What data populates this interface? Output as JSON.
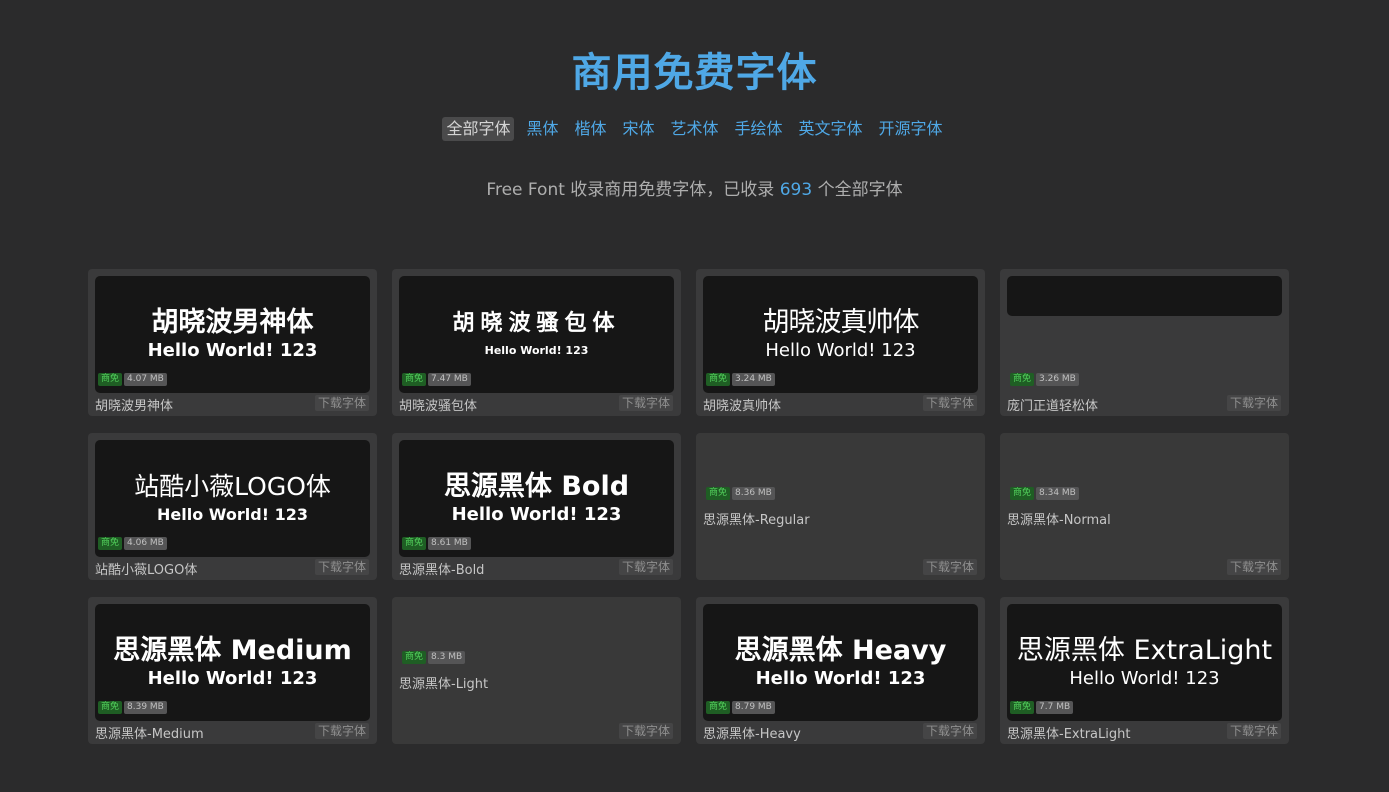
{
  "header": {
    "title": "商用免费字体",
    "nav": [
      "全部字体",
      "黑体",
      "楷体",
      "宋体",
      "艺术体",
      "手绘体",
      "英文字体",
      "开源字体"
    ],
    "subtitle_prefix": "Free Font 收录商用免费字体，已收录",
    "count": "693",
    "subtitle_suffix": "个全部字体"
  },
  "colors": {
    "accent": "#4fa8e6",
    "background": "#2b2b2c",
    "free_badge": "#52d05c"
  },
  "labels": {
    "free": "商免",
    "download": "下载字体"
  },
  "fonts": [
    {
      "name": "胡晓波男神体",
      "size": "4.07 MB",
      "preview1": "胡晓波男神体",
      "preview2": "Hello World! 123",
      "style": "bold"
    },
    {
      "name": "胡晓波骚包体",
      "size": "7.47 MB",
      "preview1": "胡晓波骚包体",
      "preview2": "Hello World! 123",
      "style": "calli"
    },
    {
      "name": "胡晓波真帅体",
      "size": "3.24 MB",
      "preview1": "胡晓波真帅体",
      "preview2": "Hello World! 123",
      "style": "thin"
    },
    {
      "name": "庞门正道轻松体",
      "size": "3.26 MB",
      "preview1": "",
      "preview2": "",
      "style": "cut"
    },
    {
      "name": "站酷小薇LOGO体",
      "size": "4.06 MB",
      "preview1": "站酷小薇LOGO体",
      "preview2": "Hello World! 123",
      "style": "logo"
    },
    {
      "name": "思源黑体-Bold",
      "size": "8.61 MB",
      "preview1": "思源黑体 Bold",
      "preview2": "Hello World! 123",
      "style": "bold"
    },
    {
      "name": "思源黑体-Regular",
      "size": "8.36 MB",
      "preview1": "",
      "preview2": "",
      "style": "plain"
    },
    {
      "name": "思源黑体-Normal",
      "size": "8.34 MB",
      "preview1": "",
      "preview2": "",
      "style": "plain"
    },
    {
      "name": "思源黑体-Medium",
      "size": "8.39 MB",
      "preview1": "思源黑体 Medium",
      "preview2": "Hello World! 123",
      "style": "medium"
    },
    {
      "name": "思源黑体-Light",
      "size": "8.3 MB",
      "preview1": "",
      "preview2": "",
      "style": "plain"
    },
    {
      "name": "思源黑体-Heavy",
      "size": "8.79 MB",
      "preview1": "思源黑体 Heavy",
      "preview2": "Hello World! 123",
      "style": "bold"
    },
    {
      "name": "思源黑体-ExtraLight",
      "size": "7.7 MB",
      "preview1": "思源黑体 ExtraLight",
      "preview2": "Hello World! 123",
      "style": "xl"
    }
  ]
}
